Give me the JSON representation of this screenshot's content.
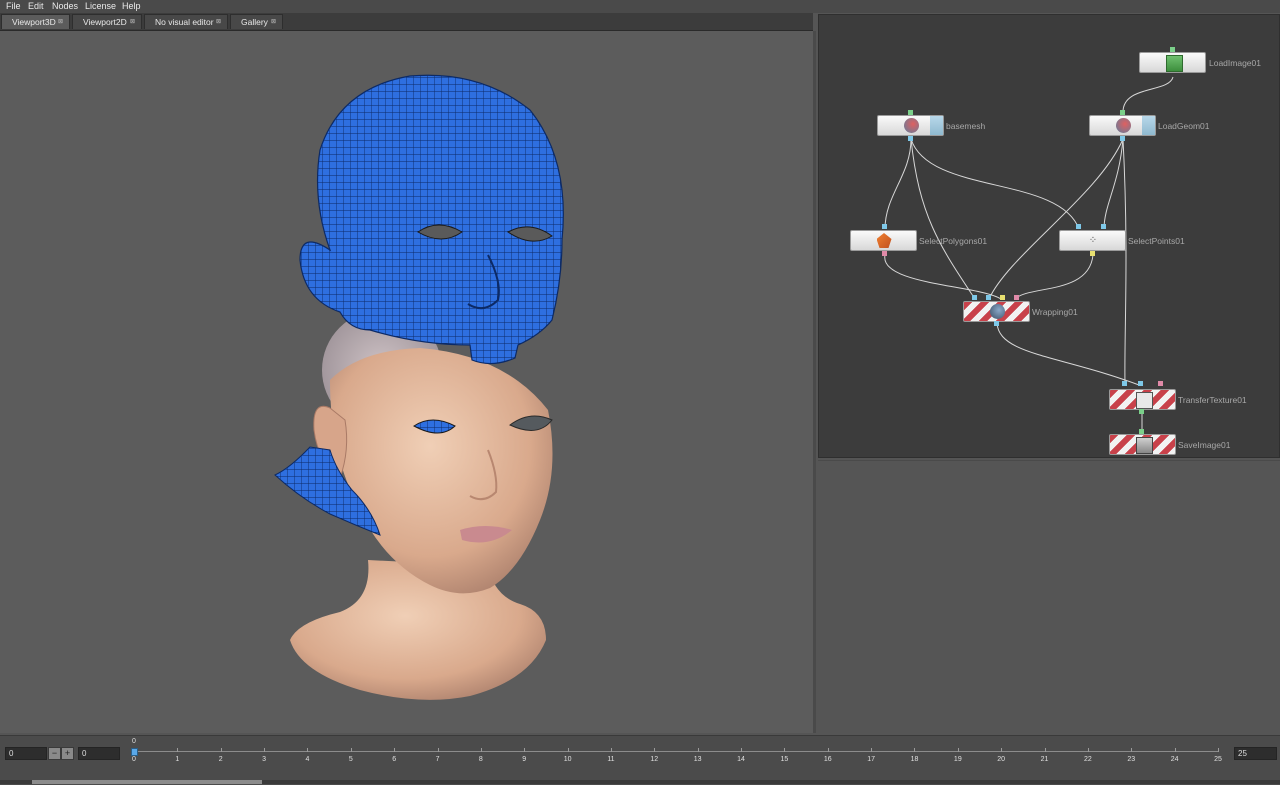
{
  "menu": [
    "File",
    "Edit",
    "Nodes",
    "License",
    "Help"
  ],
  "tabs": [
    {
      "label": "Viewport3D",
      "active": true
    },
    {
      "label": "Viewport2D",
      "active": false
    },
    {
      "label": "No visual editor",
      "active": false
    },
    {
      "label": "Gallery",
      "active": false
    }
  ],
  "nodes": {
    "loadimage": "LoadImage01",
    "basemesh": "basemesh",
    "loadgeom": "LoadGeom01",
    "selectpolygons": "SelectPolygons01",
    "selectpoints": "SelectPoints01",
    "wrapping": "Wrapping01",
    "transfertexture": "TransferTexture01",
    "saveimage": "SaveImage01"
  },
  "timeline": {
    "start_frame": "0",
    "current_frame": "0",
    "end_frame": "25",
    "minus": "−",
    "plus": "+",
    "marker": "0",
    "ticks": [
      "0",
      "1",
      "2",
      "3",
      "4",
      "5",
      "6",
      "7",
      "8",
      "9",
      "10",
      "11",
      "12",
      "13",
      "14",
      "15",
      "16",
      "17",
      "18",
      "19",
      "20",
      "21",
      "22",
      "23",
      "24",
      "25"
    ]
  },
  "colors": {
    "mesh_blue": "#2e6fe0",
    "error_red": "#c8414a",
    "port_green": "#7bd08a",
    "port_blue": "#7ec8e8",
    "port_pink": "#e08aa8",
    "port_yellow": "#e8e070"
  }
}
